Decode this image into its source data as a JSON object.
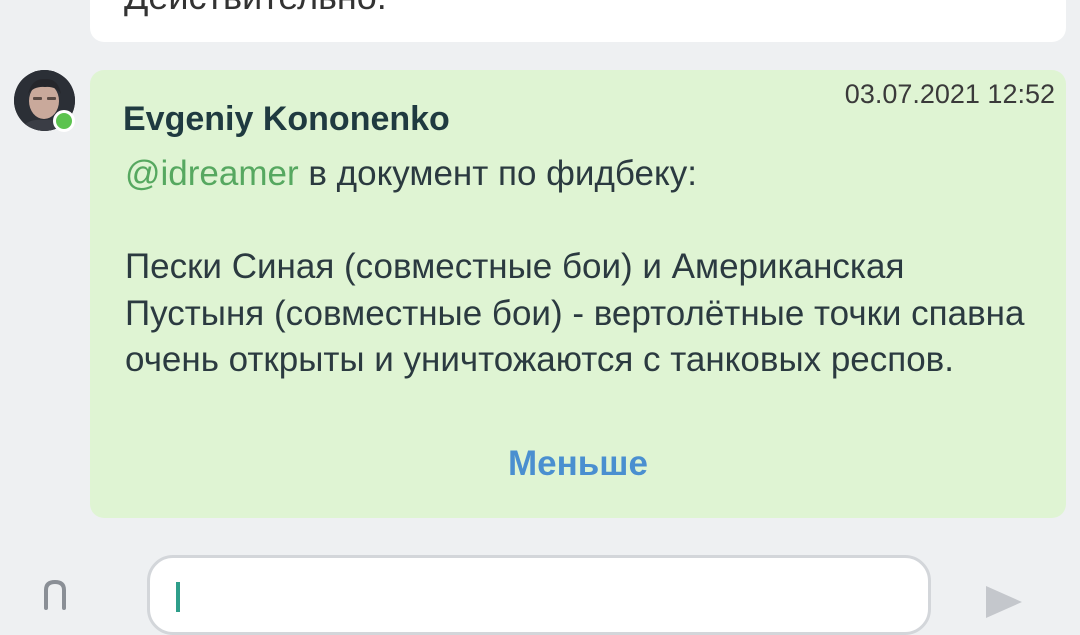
{
  "previous_message": {
    "text": "Действительно."
  },
  "message": {
    "author": "Evgeniy Kononenko",
    "timestamp": "03.07.2021 12:52",
    "mention": "@idreamer",
    "first_line_rest": " в документ по фидбеку:",
    "body": "Пески Синая (совместные бои) и Американская Пустыня (совместные бои) - вертолётные точки спавна очень открыты и уничтожаются с танковых респов.",
    "collapse_label": "Меньше",
    "online": true
  },
  "composer": {
    "input_value": "",
    "attach_icon": "paperclip-icon",
    "send_icon": "send-icon"
  },
  "colors": {
    "background": "#eef0f2",
    "bubble_incoming": "#dff4d3",
    "mention": "#56a860",
    "link": "#4a8fd0",
    "online": "#5cc34f"
  }
}
